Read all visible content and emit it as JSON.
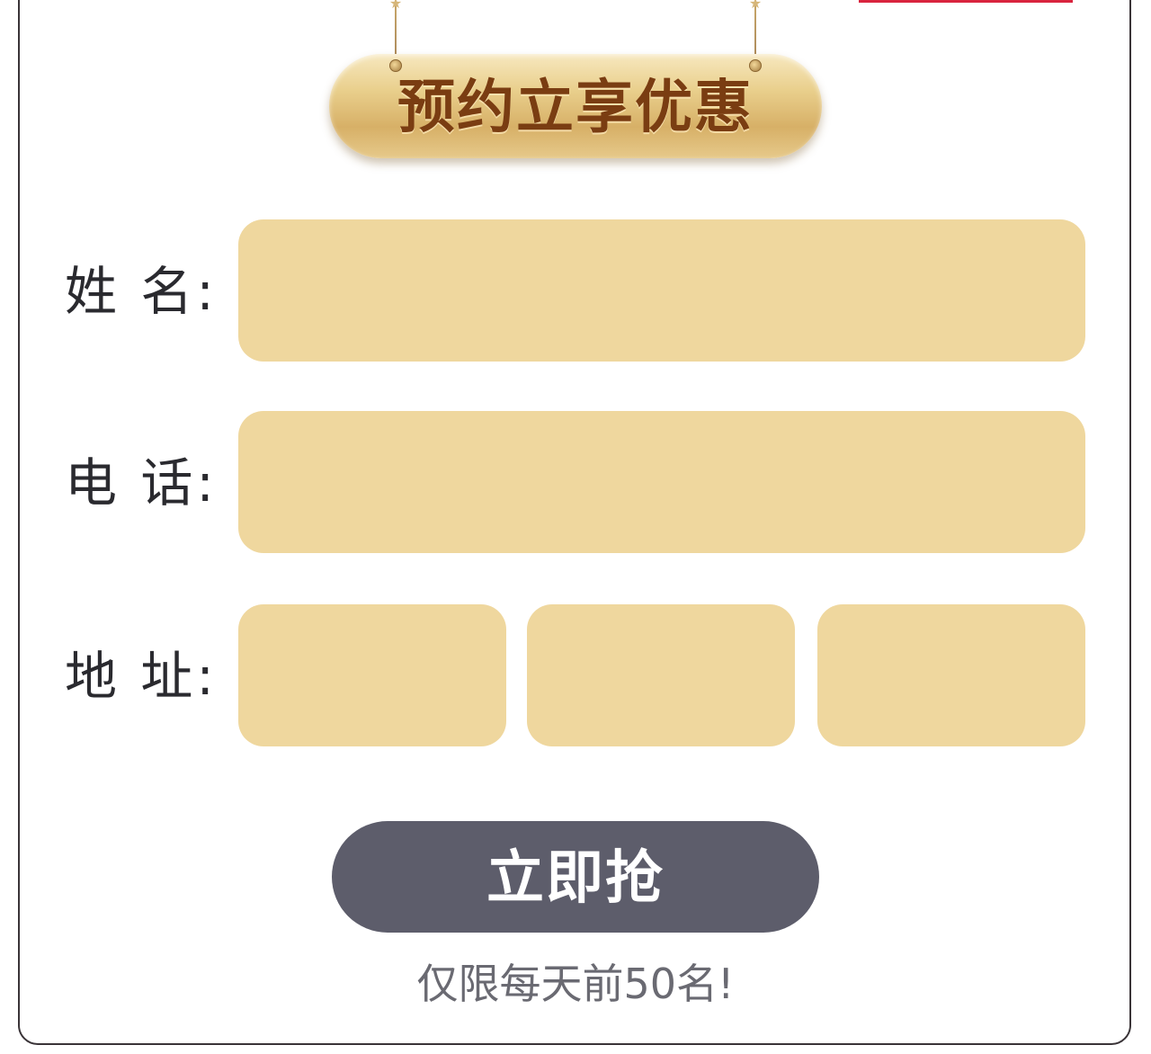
{
  "banner": {
    "title": "预约立享优惠"
  },
  "form": {
    "name_label": "姓 名:",
    "phone_label": "电 话:",
    "address_label": "地 址:",
    "name_value": "",
    "phone_value": "",
    "address_province_value": "",
    "address_city_value": "",
    "address_district_value": ""
  },
  "submit": {
    "label": "立即抢"
  },
  "note": {
    "text": "仅限每天前50名!"
  },
  "colors": {
    "field_bg": "#efd79e",
    "button_bg": "#5d5d6b",
    "banner_text": "#7a3d12",
    "accent_red": "#d9243e"
  },
  "icons": {
    "hanging_star": "star-icon",
    "screw": "screw-icon"
  }
}
